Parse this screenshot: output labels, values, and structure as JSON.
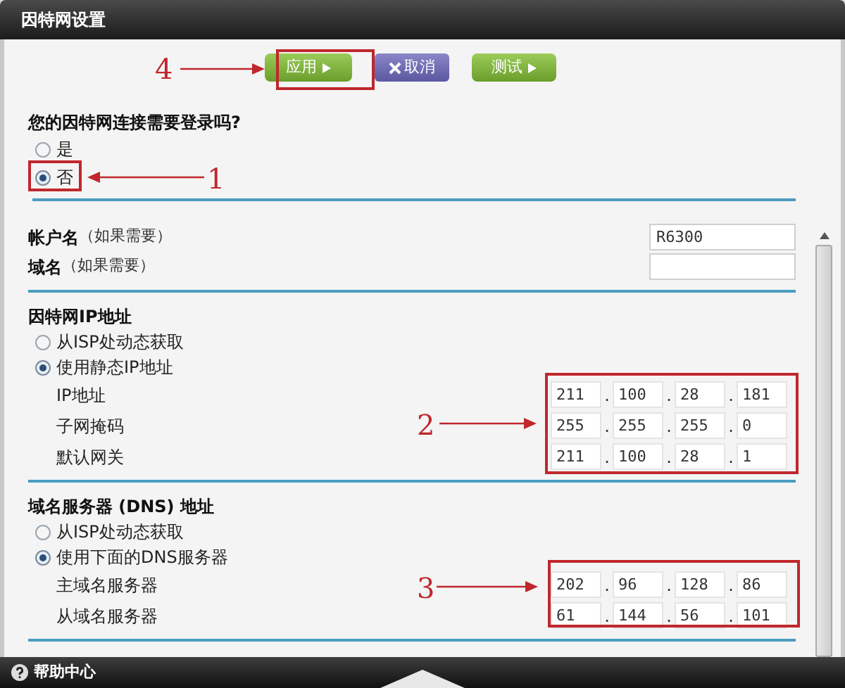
{
  "window": {
    "title": "因特网设置"
  },
  "buttons": [
    {
      "label": "应用",
      "kind": "apply"
    },
    {
      "label": "取消",
      "kind": "cancel"
    },
    {
      "label": "测试",
      "kind": "test"
    }
  ],
  "login_question": {
    "label": "您的因特网连接需要登录吗?",
    "options": [
      {
        "label": "是",
        "selected": false
      },
      {
        "label": "否",
        "selected": true
      }
    ]
  },
  "account_fields": [
    {
      "label": "帐户名",
      "hint": "（如果需要）",
      "value": "R6300"
    },
    {
      "label": "域名",
      "hint": "（如果需要）"
    }
  ],
  "octet_separator": ".",
  "sections": [
    {
      "title": "因特网IP地址",
      "modes": [
        {
          "label": "从ISP处动态获取",
          "selected": false
        },
        {
          "label": "使用静态IP地址",
          "selected": true
        }
      ],
      "rows": [
        {
          "label": "IP地址",
          "octets": [
            "211",
            "100",
            "28",
            "181"
          ]
        },
        {
          "label": "子网掩码",
          "octets": [
            "255",
            "255",
            "255",
            "0"
          ]
        },
        {
          "label": "默认网关",
          "octets": [
            "211",
            "100",
            "28",
            "1"
          ]
        }
      ]
    },
    {
      "title": "域名服务器 (DNS) 地址",
      "modes": [
        {
          "label": "从ISP处动态获取",
          "selected": false
        },
        {
          "label": "使用下面的DNS服务器",
          "selected": true
        }
      ],
      "rows": [
        {
          "label": "主域名服务器",
          "octets": [
            "202",
            "96",
            "128",
            "86"
          ]
        },
        {
          "label": "从域名服务器",
          "octets": [
            "61",
            "144",
            "56",
            "101"
          ]
        }
      ]
    }
  ],
  "annotations": [
    {
      "label": "4"
    },
    {
      "label": "1"
    },
    {
      "label": "2"
    },
    {
      "label": "3"
    }
  ],
  "footer": {
    "help": "帮助中心"
  }
}
